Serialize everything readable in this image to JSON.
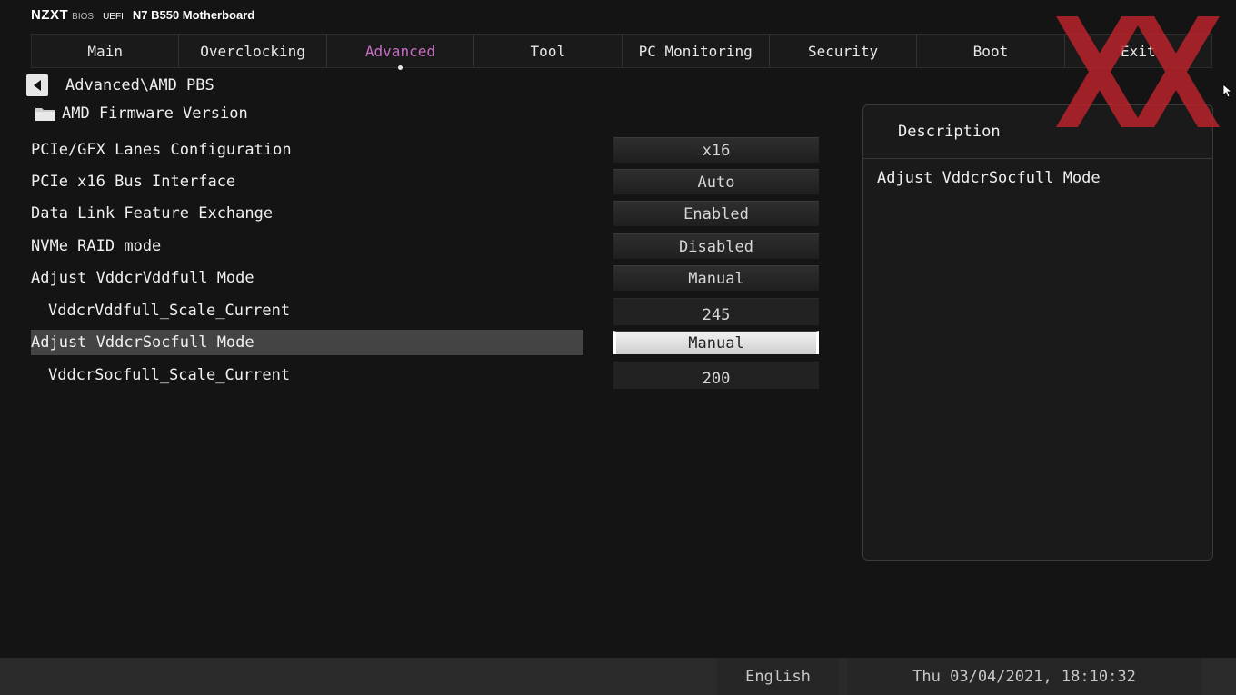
{
  "header": {
    "brand": "NZXT",
    "bios_label": "BIOS",
    "uefi_label": "UEFI",
    "model": "N7 B550 Motherboard"
  },
  "tabs": [
    {
      "label": "Main"
    },
    {
      "label": "Overclocking"
    },
    {
      "label": "Advanced",
      "active": true
    },
    {
      "label": "Tool"
    },
    {
      "label": "PC Monitoring"
    },
    {
      "label": "Security"
    },
    {
      "label": "Boot"
    },
    {
      "label": "Exit"
    }
  ],
  "breadcrumb": "Advanced\\AMD PBS",
  "submenu": {
    "label": "AMD Firmware Version",
    "icon": "folder-icon"
  },
  "settings": [
    {
      "label": "PCIe/GFX Lanes Configuration",
      "value": "x16"
    },
    {
      "label": "PCIe x16 Bus Interface",
      "value": "Auto"
    },
    {
      "label": "Data Link Feature Exchange",
      "value": "Enabled"
    },
    {
      "label": "NVMe RAID mode",
      "value": "Disabled"
    },
    {
      "label": "Adjust VddcrVddfull Mode",
      "value": "Manual"
    },
    {
      "label": "VddcrVddfull_Scale_Current",
      "value": "245"
    },
    {
      "label": "Adjust VddcrSocfull Mode",
      "value": "Manual",
      "selected": true
    },
    {
      "label": "VddcrSocfull_Scale_Current",
      "value": "200"
    }
  ],
  "description": {
    "title": "Description",
    "text": "Adjust VddcrSocfull Mode"
  },
  "footer": {
    "language": "English",
    "datetime": "Thu 03/04/2021, 18:10:32"
  },
  "colors": {
    "accent_tab": "#c86dc4",
    "background": "#141414",
    "watermark": "#b8232a"
  }
}
